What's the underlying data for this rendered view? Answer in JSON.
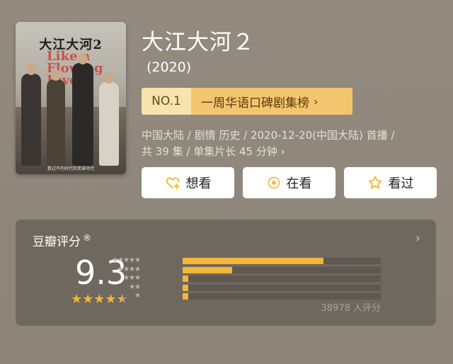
{
  "poster": {
    "title_zh": "大江大河2",
    "title_en": "Like a Flowing River",
    "tagline": "数过不朽时代的变革时代"
  },
  "title": "大江大河２",
  "year": "(2020)",
  "rank": {
    "no": "NO.1",
    "label": "一周华语口碑剧集榜",
    "chevron": "›"
  },
  "meta": {
    "line1": "中国大陆 / 剧情 历史 / 2020-12-20(中国大陆) 首播 /",
    "line2": "共 39 集 / 单集片长 45 分钟",
    "chevron": "›"
  },
  "actions": {
    "want": "想看",
    "doing": "在看",
    "done": "看过"
  },
  "rating": {
    "heading": "豆瓣评分",
    "reg_mark": "®",
    "arrow": "›",
    "score": "9.3",
    "stars": 4.5,
    "distribution": [
      {
        "stars": "★★★★★",
        "fraction": 0.71
      },
      {
        "stars": "★★★★",
        "fraction": 0.25
      },
      {
        "stars": "★★★",
        "fraction": 0.03
      },
      {
        "stars": "★★",
        "fraction": 0.01
      },
      {
        "stars": "★",
        "fraction": 0.01
      }
    ],
    "count": "38978 人评分"
  },
  "colors": {
    "accent": "#f4b53a",
    "rank_no_bg": "#f6e3ad",
    "rank_label_bg": "#f3c56f",
    "background": "#8f877b",
    "card": "#6f685f"
  }
}
